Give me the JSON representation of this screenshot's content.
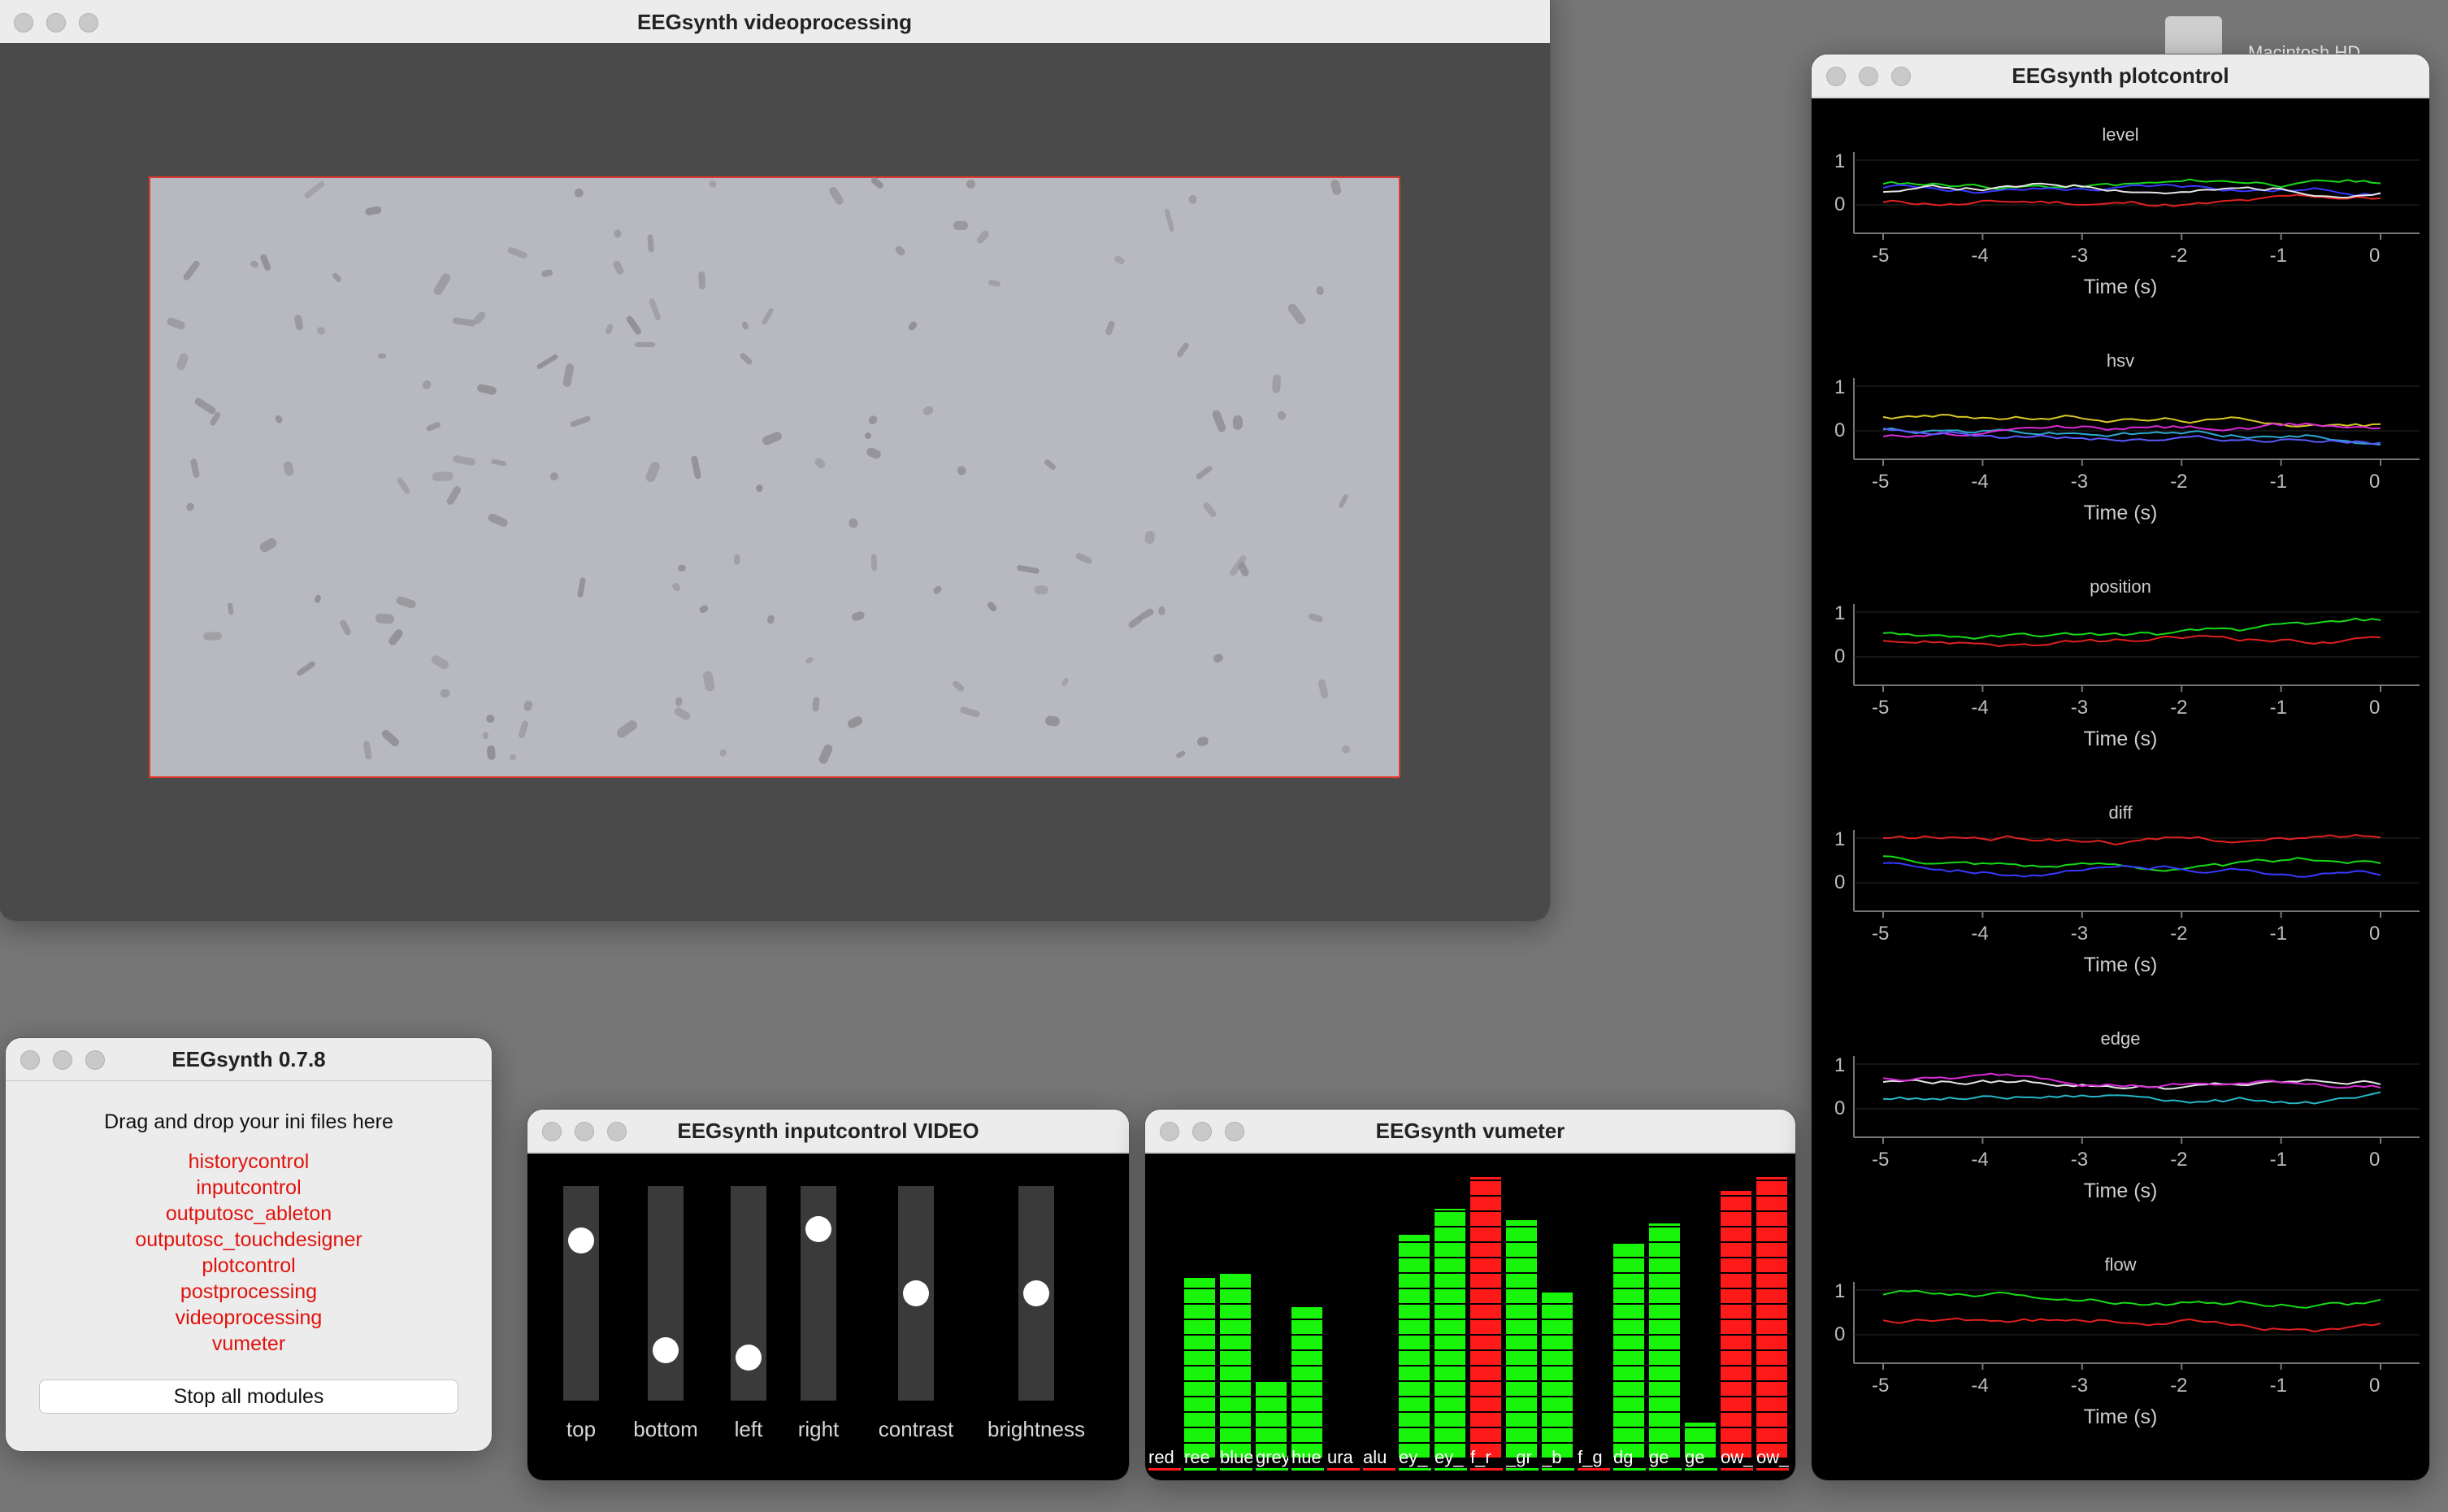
{
  "desktop": {
    "hd_label": "Macintosh HD"
  },
  "video_window": {
    "title": "EEGsynth videoprocessing"
  },
  "main_window": {
    "title": "EEGsynth 0.7.8",
    "drag_text": "Drag and drop your ini files here",
    "modules": [
      "historycontrol",
      "inputcontrol",
      "outputosc_ableton",
      "outputosc_touchdesigner",
      "plotcontrol",
      "postprocessing",
      "videoprocessing",
      "vumeter"
    ],
    "stop_button": "Stop all modules",
    "module_color": "#e0120c"
  },
  "input_window": {
    "title": "EEGsynth inputcontrol VIDEO",
    "sliders": [
      {
        "label": "top",
        "value": 0.78
      },
      {
        "label": "bottom",
        "value": 0.2
      },
      {
        "label": "left",
        "value": 0.16
      },
      {
        "label": "right",
        "value": 0.84
      },
      {
        "label": "contrast",
        "value": 0.5
      },
      {
        "label": "brightness",
        "value": 0.5
      }
    ]
  },
  "vu_window": {
    "title": "EEGsynth vumeter",
    "bars": [
      {
        "label": "red",
        "value": 0.0,
        "color": "green"
      },
      {
        "label": "ree",
        "value": 0.62,
        "color": "green"
      },
      {
        "label": "blue",
        "value": 0.64,
        "color": "green"
      },
      {
        "label": "grey",
        "value": 0.26,
        "color": "green"
      },
      {
        "label": "hue",
        "value": 0.52,
        "color": "green"
      },
      {
        "label": "ura",
        "value": 0.0,
        "color": "green"
      },
      {
        "label": "alu",
        "value": 0.0,
        "color": "green"
      },
      {
        "label": "ey_",
        "value": 0.77,
        "color": "green"
      },
      {
        "label": "ey_",
        "value": 0.86,
        "color": "green"
      },
      {
        "label": "f_r",
        "value": 0.97,
        "color": "red"
      },
      {
        "label": "_gr",
        "value": 0.82,
        "color": "green"
      },
      {
        "label": "_b",
        "value": 0.57,
        "color": "green"
      },
      {
        "label": "f_g",
        "value": 0.0,
        "color": "green"
      },
      {
        "label": "dg",
        "value": 0.74,
        "color": "green"
      },
      {
        "label": "ge",
        "value": 0.81,
        "color": "green"
      },
      {
        "label": "ge",
        "value": 0.12,
        "color": "green"
      },
      {
        "label": "ow_",
        "value": 0.92,
        "color": "red"
      },
      {
        "label": "ow_",
        "value": 0.97,
        "color": "red"
      }
    ],
    "green": "#19f50a",
    "red": "#ff1a1a"
  },
  "plot_window": {
    "title": "EEGsynth plotcontrol",
    "xlabel": "Time (s)",
    "xticks": [
      "-5",
      "-4",
      "-3",
      "-2",
      "-1",
      "0"
    ],
    "panels": [
      {
        "title": "level",
        "yticks": [
          "1",
          "0"
        ]
      },
      {
        "title": "hsv",
        "yticks": [
          "1",
          "0"
        ]
      },
      {
        "title": "position",
        "yticks": [
          "1",
          "0"
        ]
      },
      {
        "title": "diff",
        "yticks": [
          "1",
          "0"
        ]
      },
      {
        "title": "edge",
        "yticks": [
          "1",
          "0"
        ]
      },
      {
        "title": "flow",
        "yticks": [
          "1",
          "0"
        ]
      }
    ]
  }
}
